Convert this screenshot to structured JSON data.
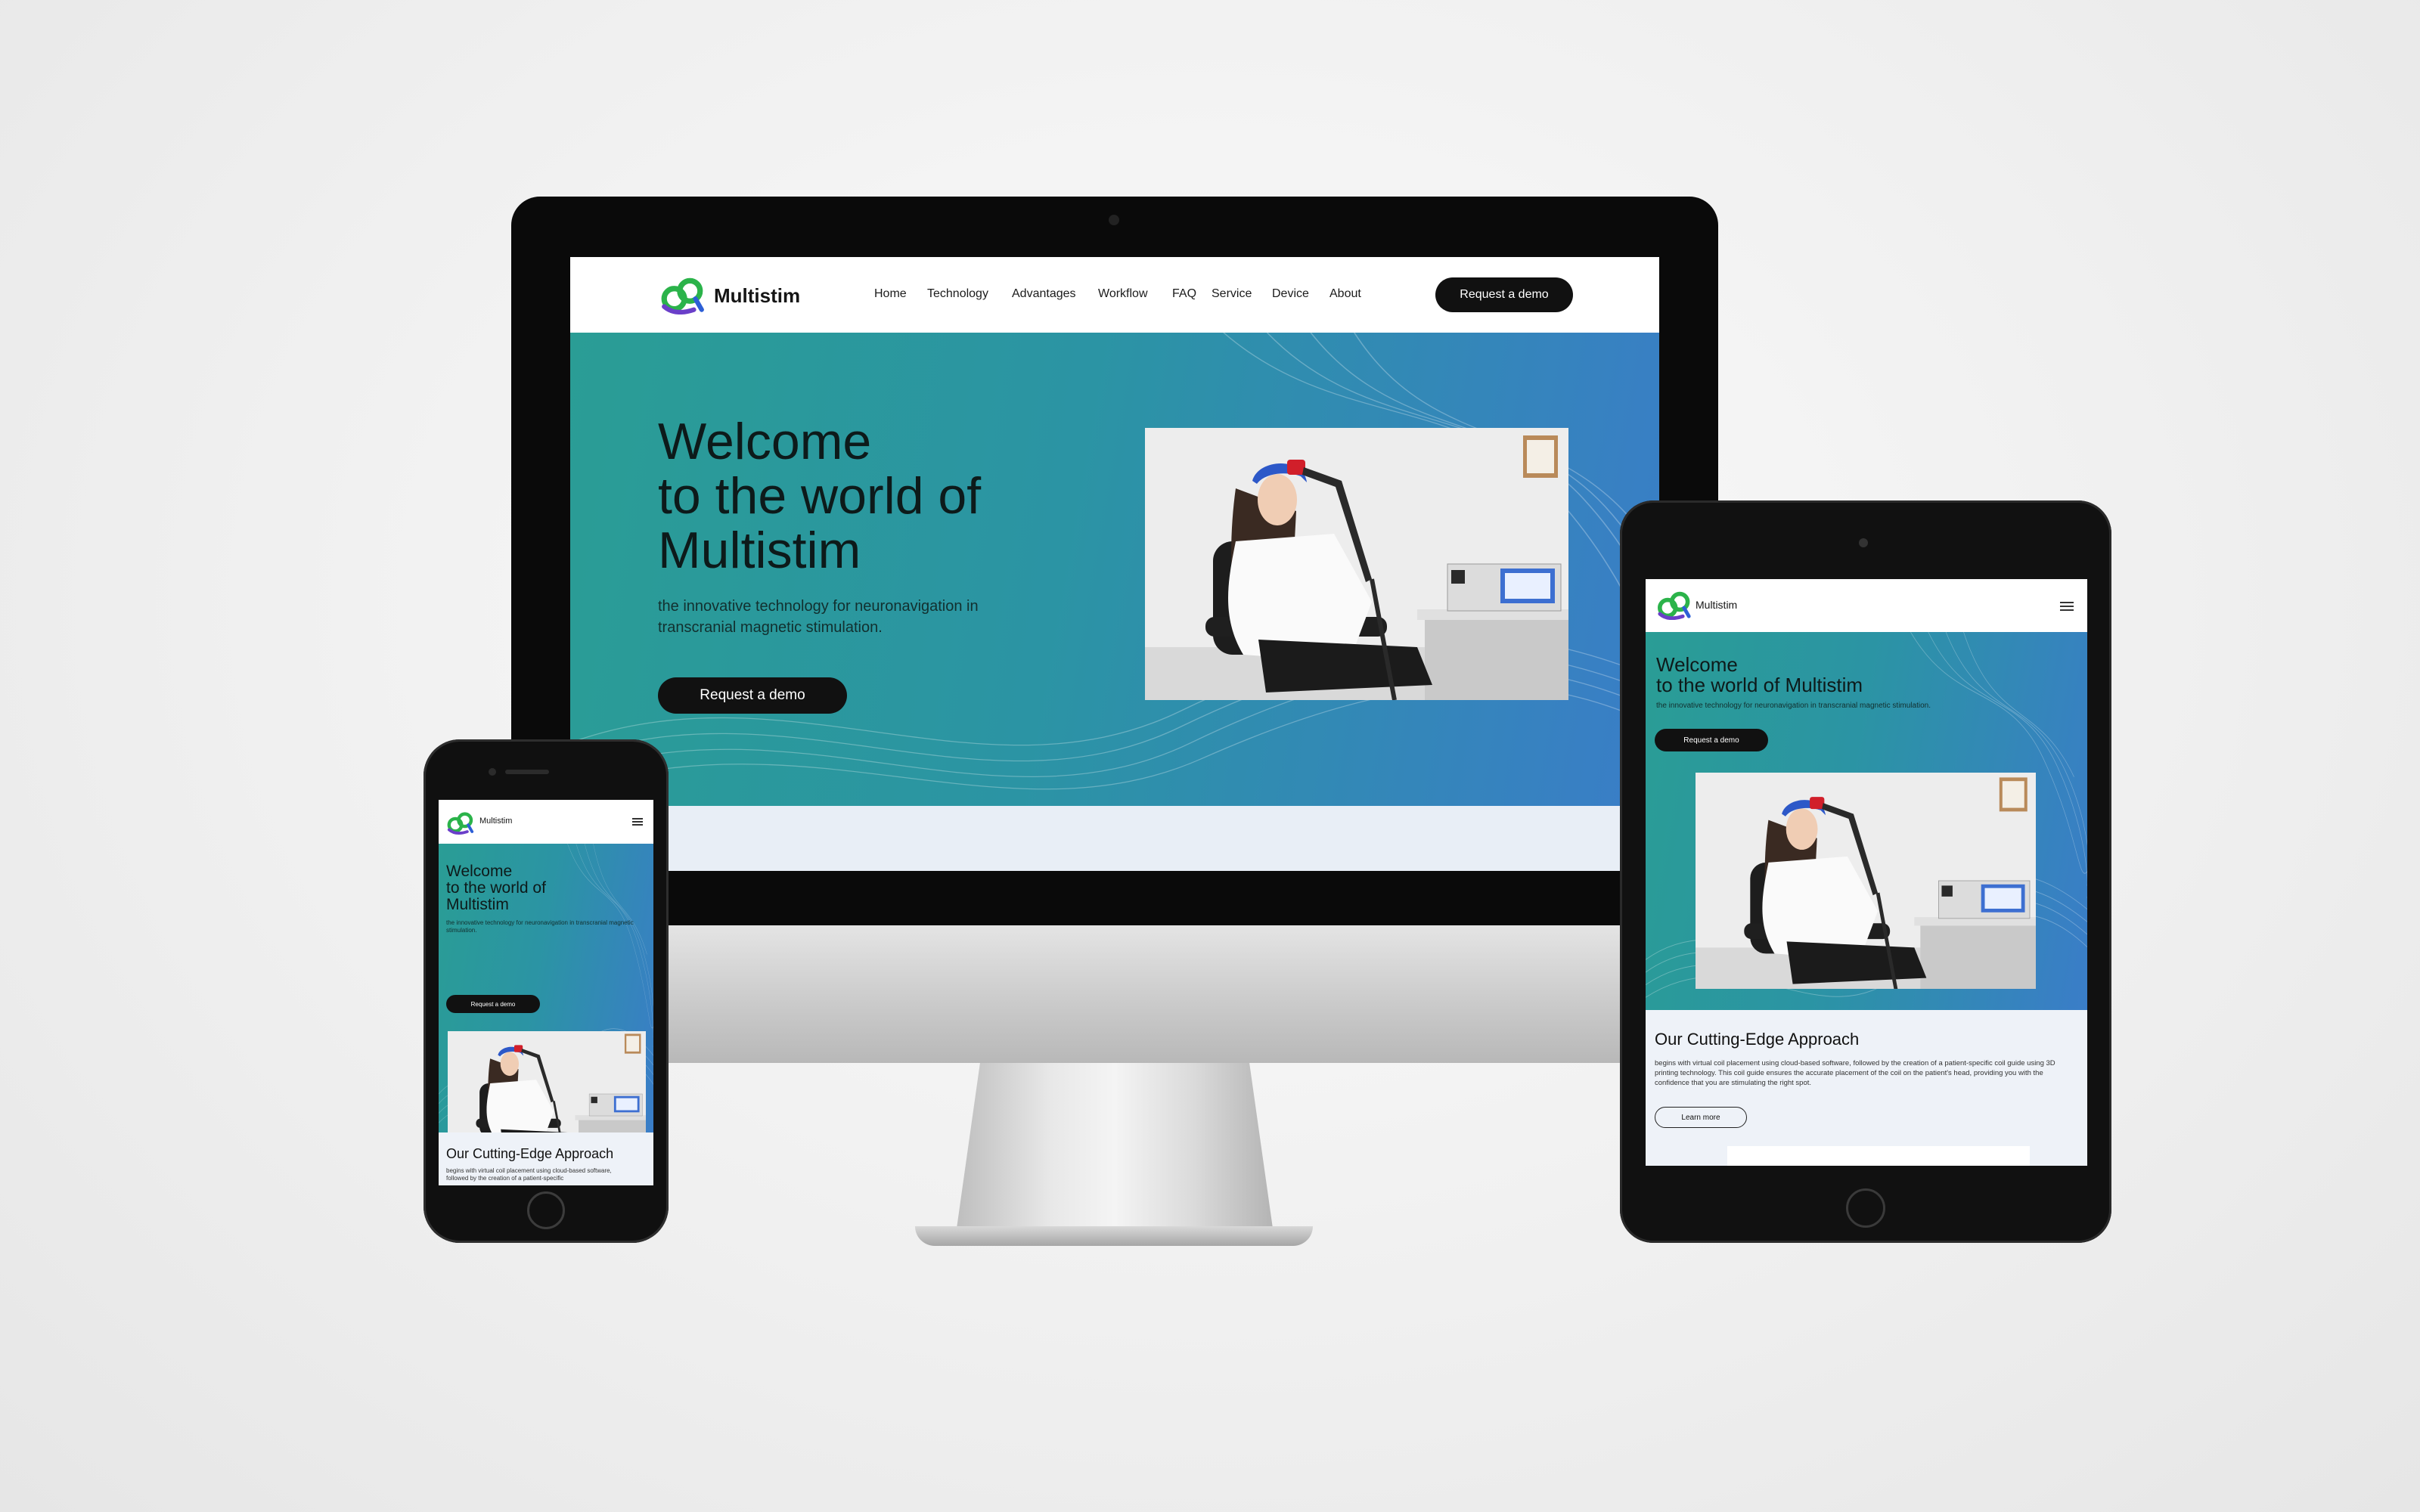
{
  "brand": {
    "name": "Multistim",
    "green": "#2bb34a",
    "blue": "#2d5fd6",
    "purple": "#6a3fc9"
  },
  "nav": {
    "items": [
      "Home",
      "Technology",
      "Advantages",
      "Workflow",
      "FAQ",
      "Service",
      "Device",
      "About"
    ],
    "cta": "Request a demo"
  },
  "hero": {
    "title_line1": "Welcome",
    "title_line2": "to the world of",
    "title_line3": "Multistim",
    "title_tablet_line2": "to the world of Multistim",
    "subtitle": "the innovative technology for neuronavigation in transcranial magnetic stimulation.",
    "cta": "Request a demo"
  },
  "approach": {
    "title": "Our Cutting-Edge Approach",
    "body": "begins with virtual coil placement using cloud-based software, followed by the creation of a patient-specific coil guide using 3D printing technology. This coil guide ensures the accurate placement of the coil on the patient's head, providing you with the confidence that you are stimulating the right spot.",
    "phone_body": "begins with virtual coil placement using cloud-based software, followed by the creation of a patient-specific",
    "cta": "Learn more"
  },
  "icons": {
    "menu": "hamburger-menu-icon",
    "logo": "multistim-logo-icon"
  }
}
